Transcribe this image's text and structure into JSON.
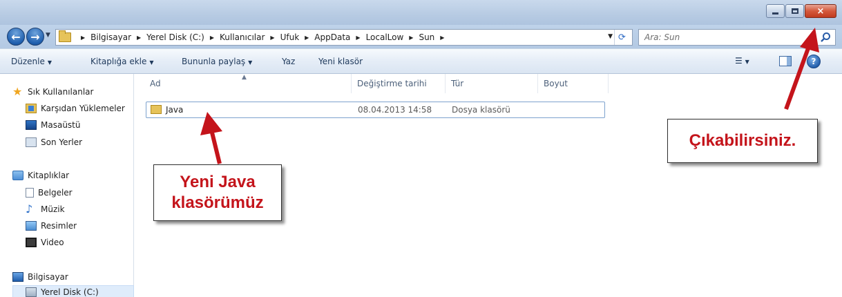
{
  "window": {
    "buttons": {
      "minimize": "minimize",
      "maximize": "maximize",
      "close": "×"
    }
  },
  "address": {
    "crumbs": [
      "Bilgisayar",
      "Yerel Disk (C:)",
      "Kullanıcılar",
      "Ufuk",
      "AppData",
      "LocalLow",
      "Sun"
    ]
  },
  "search": {
    "placeholder": "Ara: Sun"
  },
  "toolbar": {
    "organize": "Düzenle",
    "add_to_library": "Kitaplığa ekle",
    "share_with": "Bununla paylaş",
    "burn": "Yaz",
    "new_folder": "Yeni klasör"
  },
  "sidebar": {
    "favorites_header": "Sık Kullanılanlar",
    "favorites": [
      "Karşıdan Yüklemeler",
      "Masaüstü",
      "Son Yerler"
    ],
    "libraries_header": "Kitaplıklar",
    "libraries": [
      "Belgeler",
      "Müzik",
      "Resimler",
      "Video"
    ],
    "computer_header": "Bilgisayar",
    "computer": [
      "Yerel Disk (C:)"
    ]
  },
  "columns": {
    "name": "Ad",
    "date": "Değiştirme tarihi",
    "type": "Tür",
    "size": "Boyut"
  },
  "files": [
    {
      "name": "Java",
      "date": "08.04.2013 14:58",
      "type": "Dosya klasörü",
      "size": ""
    }
  ],
  "annotations": {
    "java_line1": "Yeni Java",
    "java_line2": "klasörümüz",
    "exit": "Çıkabilirsiniz."
  },
  "colors": {
    "annotation_text": "#c4141b",
    "arrow": "#c4141b"
  }
}
